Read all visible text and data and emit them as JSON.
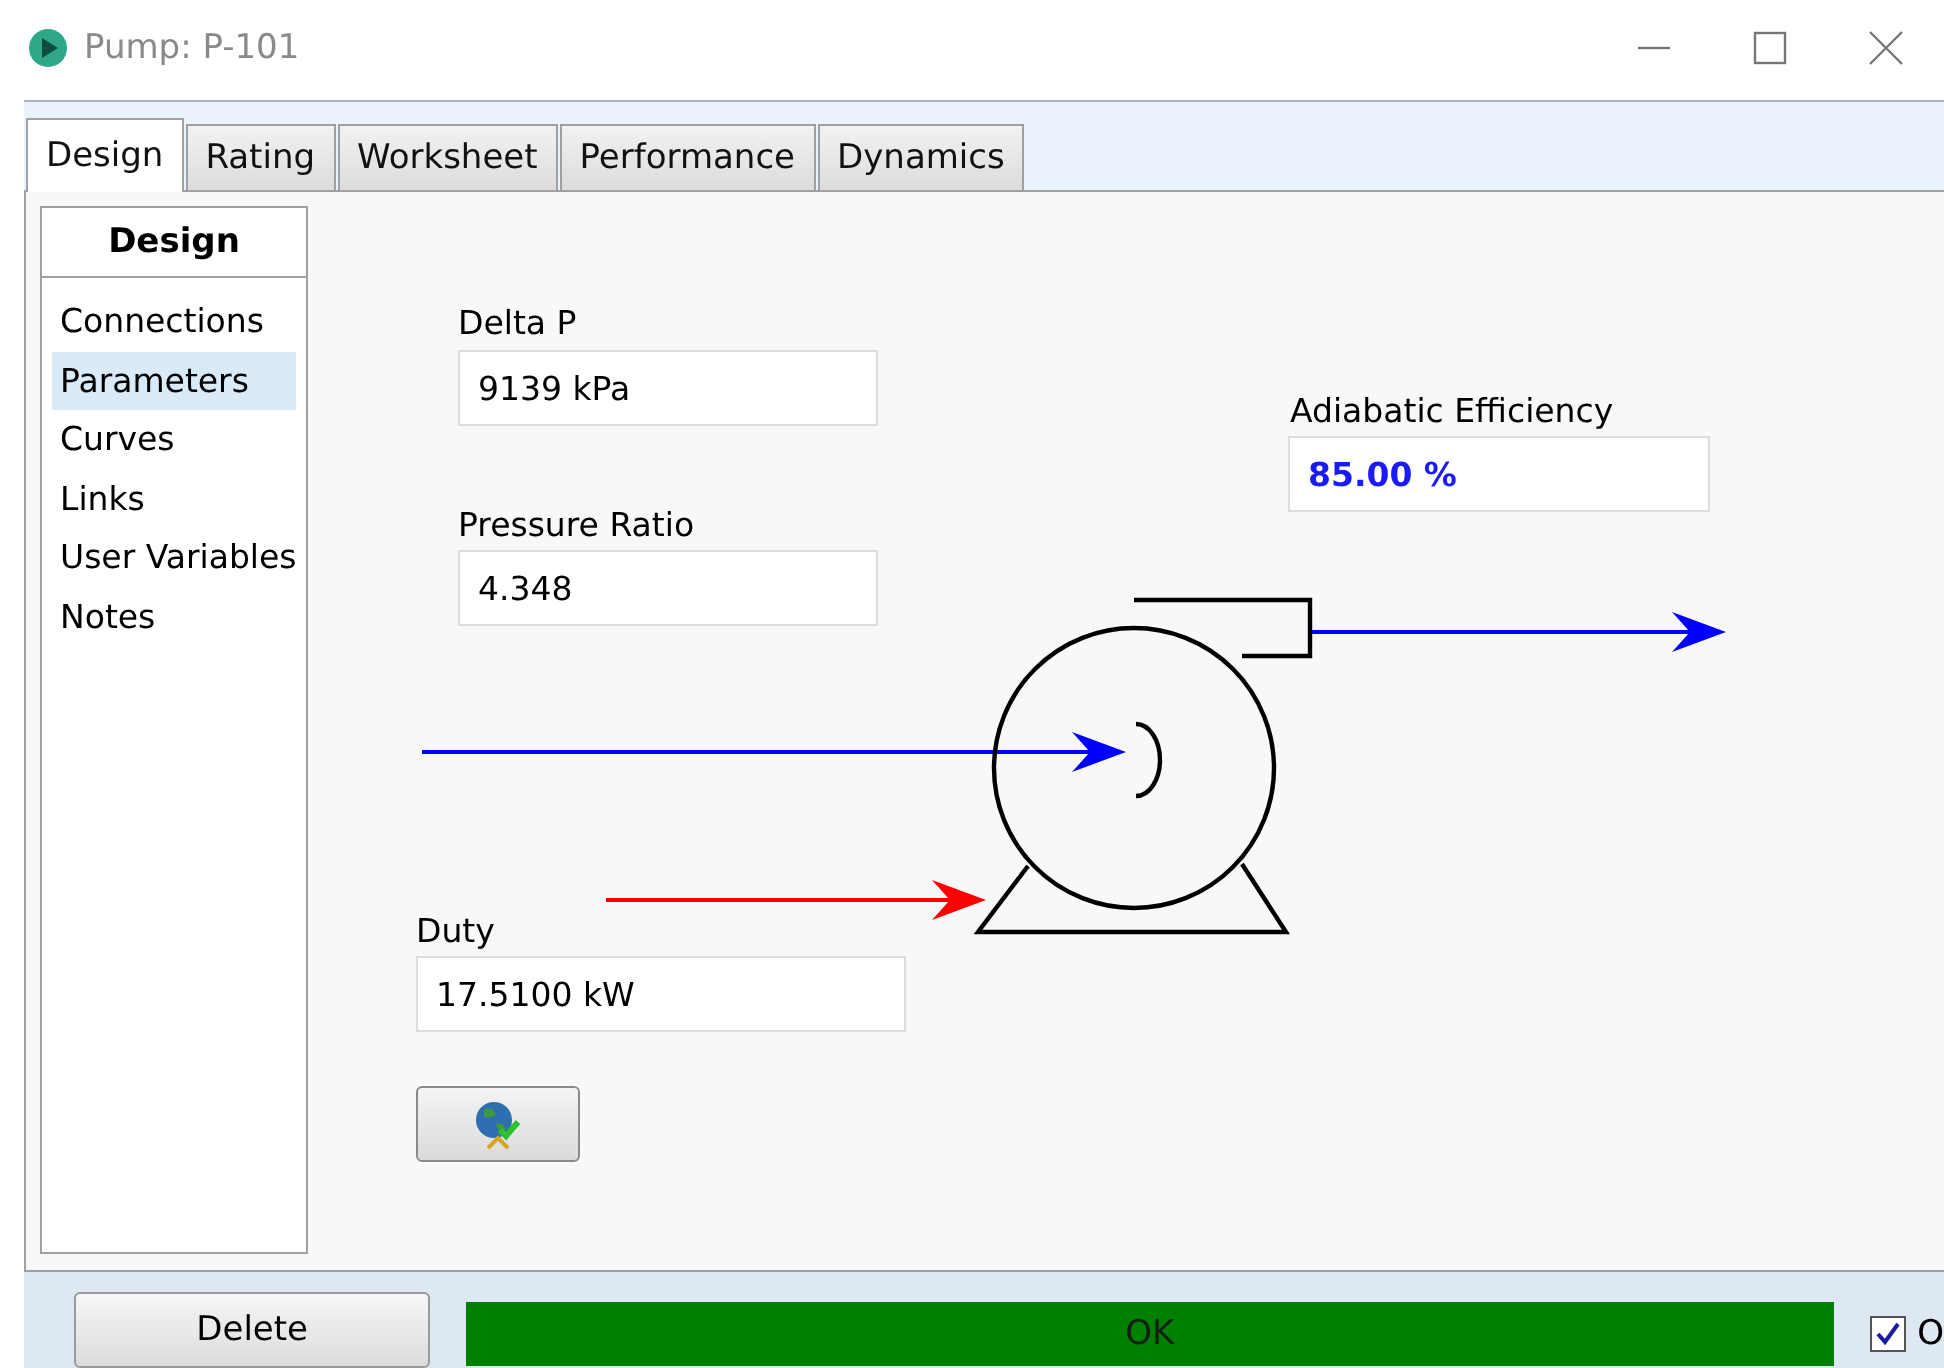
{
  "window": {
    "title": "Pump: P-101"
  },
  "tabs": [
    {
      "label": "Design",
      "selected": true
    },
    {
      "label": "Rating",
      "selected": false
    },
    {
      "label": "Worksheet",
      "selected": false
    },
    {
      "label": "Performance",
      "selected": false
    },
    {
      "label": "Dynamics",
      "selected": false
    }
  ],
  "sidebar": {
    "header": "Design",
    "items": [
      {
        "label": "Connections",
        "selected": false
      },
      {
        "label": "Parameters",
        "selected": true
      },
      {
        "label": "Curves",
        "selected": false
      },
      {
        "label": "Links",
        "selected": false
      },
      {
        "label": "User Variables",
        "selected": false
      },
      {
        "label": "Notes",
        "selected": false
      }
    ]
  },
  "fields": [
    {
      "label": "Delta P",
      "value": "9139 kPa",
      "kind": "calculated"
    },
    {
      "label": "Pressure Ratio",
      "value": "4.348",
      "kind": "calculated"
    },
    {
      "label": "Adiabatic Efficiency",
      "value": "85.00 %",
      "kind": "specified"
    },
    {
      "label": "Duty",
      "value": "17.5100 kW",
      "kind": "calculated"
    }
  ],
  "footer": {
    "delete_button": "Delete",
    "status": "OK",
    "checkbox": {
      "label": "O",
      "checked": true
    }
  }
}
